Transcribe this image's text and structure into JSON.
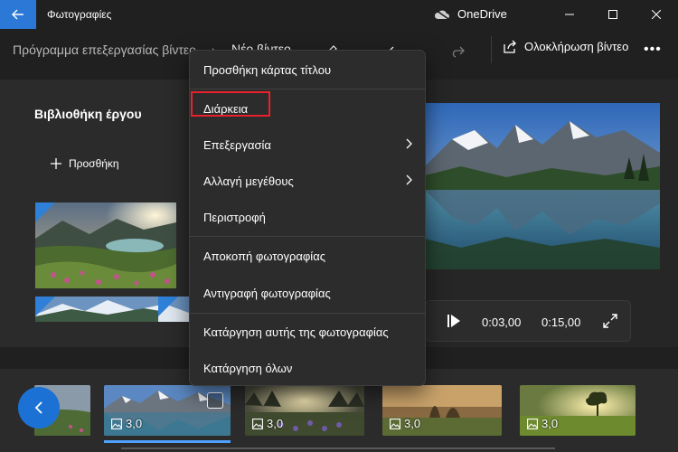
{
  "titlebar": {
    "app_title": "Φωτογραφίες",
    "onedrive_label": "OneDrive"
  },
  "cmdbar": {
    "breadcrumb_parent": "Πρόγραμμα επεξεργασίας βίντεο",
    "breadcrumb_separator": "›",
    "breadcrumb_current": "Νέο βίντεο",
    "finish_label": "Ολοκλήρωση βίντεο",
    "more_label": "•••"
  },
  "library": {
    "title": "Βιβλιοθήκη έργου",
    "add_label": "Προσθήκη"
  },
  "player": {
    "current_time": "0:03,00",
    "total_time": "0:15,00"
  },
  "storyboard": {
    "items": [
      {
        "duration": "3,0"
      },
      {
        "duration": "3,0"
      },
      {
        "duration": "3,0"
      },
      {
        "duration": "3,0"
      }
    ]
  },
  "menu": {
    "items": [
      {
        "label": "Προσθήκη κάρτας τίτλου"
      },
      {
        "label": "Διάρκεια"
      },
      {
        "label": "Επεξεργασία"
      },
      {
        "label": "Αλλαγή μεγέθους"
      },
      {
        "label": "Περιστροφή"
      },
      {
        "label": "Αποκοπή φωτογραφίας"
      },
      {
        "label": "Αντιγραφή φωτογραφίας"
      },
      {
        "label": "Κατάργηση αυτής της φωτογραφίας"
      },
      {
        "label": "Κατάργηση όλων"
      }
    ]
  },
  "colors": {
    "accent": "#2b78d6",
    "highlight_outline": "#e8212b"
  }
}
